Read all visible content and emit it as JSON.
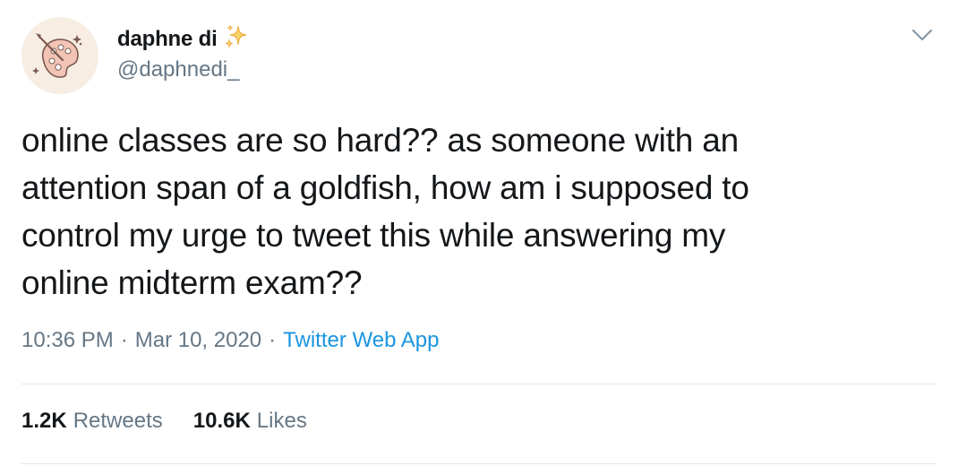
{
  "author": {
    "display_name": "daphne di",
    "name_emoji": "sparkles-icon",
    "handle": "@daphnedi_",
    "avatar": "painter-palette-avatar"
  },
  "tweet": {
    "lines": [
      "online classes are so hard?? as someone with an",
      "attention span of a goldfish, how am i supposed to",
      "control my urge to tweet this while answering my",
      "online midterm exam??"
    ]
  },
  "meta": {
    "time": "10:36 PM",
    "separator": "·",
    "date": "Mar 10, 2020",
    "source": "Twitter Web App"
  },
  "stats": {
    "retweets_count": "1.2K",
    "retweets_label": "Retweets",
    "likes_count": "10.6K",
    "likes_label": "Likes"
  },
  "colors": {
    "text": "#14171a",
    "secondary": "#657786",
    "link": "#1b95e0",
    "divider": "#e1e8ed",
    "sparkle": "#f5b942",
    "avatar_bg": "#f8ede3"
  },
  "icons": {
    "menu": "chevron-down-icon"
  }
}
